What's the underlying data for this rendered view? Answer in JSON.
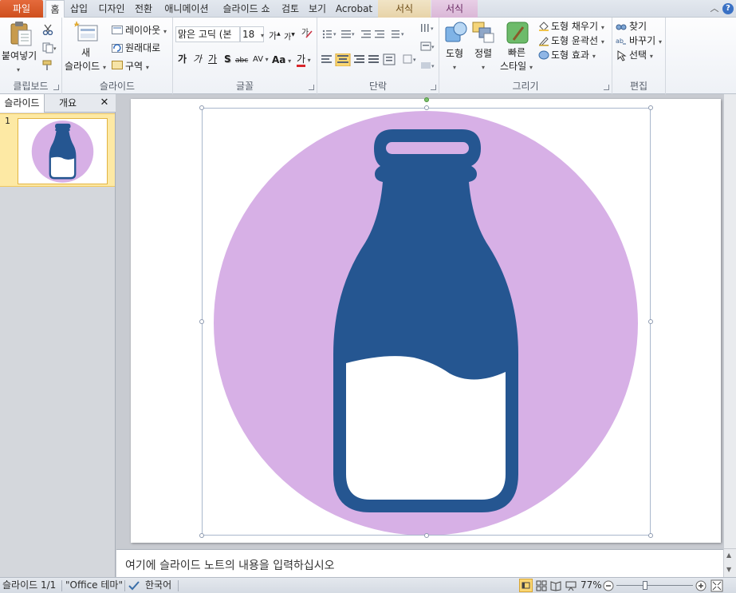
{
  "tabs": {
    "file": "파일",
    "home": "홈",
    "insert": "삽입",
    "design": "디자인",
    "transitions": "전환",
    "animations": "애니메이션",
    "slideshow": "슬라이드 쇼",
    "review": "검토",
    "view": "보기",
    "acrobat": "Acrobat",
    "format1": "서식",
    "format2": "서식"
  },
  "ribbon": {
    "clipboard": {
      "paste_label": "붙여넣기",
      "group_label": "클립보드"
    },
    "slides": {
      "new_slide_line1": "새",
      "new_slide_line2": "슬라이드",
      "layout": "레이아웃",
      "reset": "원래대로",
      "section": "구역",
      "group_label": "슬라이드"
    },
    "font": {
      "font_name": "맑은 고딕 (본",
      "font_size": "18",
      "grow": "가",
      "shrink": "가",
      "bold": "가",
      "italic": "가",
      "underline": "가",
      "shadow": "S",
      "strike": "abc",
      "spacing": "AV",
      "case": "Aa",
      "color": "가",
      "group_label": "글꼴"
    },
    "paragraph": {
      "group_label": "단락"
    },
    "drawing": {
      "shapes": "도형",
      "arrange": "정렬",
      "quick_styles_line1": "빠른",
      "quick_styles_line2": "스타일",
      "fill": "도형 채우기",
      "outline": "도형 윤곽선",
      "effects": "도형 효과",
      "group_label": "그리기"
    },
    "editing": {
      "find": "찾기",
      "replace": "바꾸기",
      "select": "선택",
      "group_label": "편집"
    }
  },
  "left_panel": {
    "tab_slides": "슬라이드",
    "tab_outline": "개요",
    "close": "✕",
    "slide_number": "1"
  },
  "notes": {
    "placeholder": "여기에 슬라이드 노트의 내용을 입력하십시오"
  },
  "status": {
    "slide_pos": "슬라이드 1/1",
    "theme": "\"Office 테마\"",
    "language": "한국어",
    "zoom": "77%"
  },
  "colors": {
    "circle": "#d7b0e6",
    "bottle": "#255691",
    "milk": "#ffffff",
    "file_tab": "#d9582a",
    "selection": "#a9b7cc"
  }
}
